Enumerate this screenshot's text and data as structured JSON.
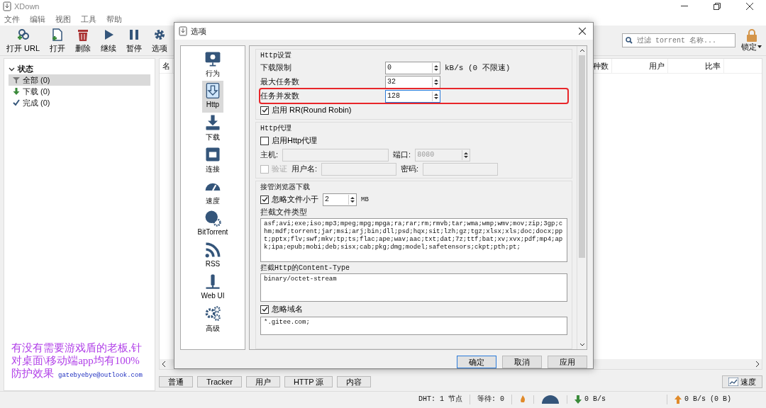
{
  "window": {
    "title": "XDown"
  },
  "menu": [
    "文件",
    "编辑",
    "视图",
    "工具",
    "帮助"
  ],
  "toolbar": [
    "打开 URL",
    "打开",
    "删除",
    "继续",
    "暂停",
    "选项"
  ],
  "search": {
    "placeholder": "过滤 torrent 名称..."
  },
  "lock": {
    "label": "锁定"
  },
  "sidebar": {
    "heading": "状态",
    "expanded": true,
    "items": [
      {
        "label": "全部 (0)",
        "selected": true
      },
      {
        "label": "下载 (0)",
        "selected": false
      },
      {
        "label": "完成 (0)",
        "selected": false
      }
    ]
  },
  "promo": {
    "text": "有没有需要游戏盾的老板,针对桌面\\移动端app均有100%防护效果",
    "link": "gatebyebye@outlook.com"
  },
  "table": {
    "columns": [
      "名",
      "种数",
      "用户",
      "比率"
    ]
  },
  "detail_tabs": [
    "普通",
    "Tracker",
    "用户",
    "HTTP 源",
    "内容"
  ],
  "speed_button": "速度",
  "status_bar": {
    "dht": "DHT: 1 节点",
    "waiting": "等待: 0",
    "download": "0 B/s",
    "upload": "0 B/s (0 B)"
  },
  "dialog": {
    "title": "选项",
    "nav": [
      {
        "label": "行为",
        "selected": false
      },
      {
        "label": "Http",
        "selected": true
      },
      {
        "label": "下载",
        "selected": false
      },
      {
        "label": "连接",
        "selected": false
      },
      {
        "label": "速度",
        "selected": false
      },
      {
        "label": "BitTorrent",
        "selected": false
      },
      {
        "label": "RSS",
        "selected": false
      },
      {
        "label": "Web UI",
        "selected": false
      },
      {
        "label": "高级",
        "selected": false
      }
    ],
    "http": {
      "title": "Http设置",
      "rows": [
        {
          "label": "下载限制",
          "value": "0",
          "suffix": "kB/s (0 不限速)",
          "highlighted": false,
          "focused": false
        },
        {
          "label": "最大任务数",
          "value": "32",
          "highlighted": false,
          "focused": false
        },
        {
          "label": "任务并发数",
          "value": "128",
          "highlighted": true,
          "focused": true
        }
      ],
      "round_robin": {
        "label": "启用 RR(Round Robin)",
        "checked": true
      }
    },
    "proxy": {
      "title": "Http代理",
      "enable": {
        "label": "启用Http代理",
        "checked": false
      },
      "disabled": true,
      "host_label": "主机:",
      "port_label": "端口:",
      "port_value": "8080",
      "auth": {
        "label": "验证",
        "checked": false
      },
      "user_label": "用户名:",
      "pass_label": "密码:"
    },
    "browser": {
      "title": "接管浏览器下载",
      "ignore_small": {
        "label": "忽略文件小于",
        "checked": true,
        "value": "2",
        "unit": "MB"
      },
      "types_label": "拦截文件类型",
      "types_text": "asf;avi;exe;iso;mp3;mpeg;mpg;mpga;ra;rar;rm;rmvb;tar;wma;wmp;wmv;mov;zip;3gp;chm;mdf;torrent;jar;msi;arj;bin;dll;psd;hqx;sit;lzh;gz;tgz;xlsx;xls;doc;docx;ppt;pptx;flv;swf;mkv;tp;ts;flac;ape;wav;aac;txt;dat;7z;ttf;bat;xv;xvx;pdf;mp4;apk;ipa;epub;mobi;deb;sisx;cab;pkg;dmg;model;safetensors;ckpt;pth;pt;",
      "content_type_label": "拦截Http的Content-Type",
      "content_type_text": "binary/octet-stream",
      "ignore_domains": {
        "label": "忽略域名",
        "checked": true
      },
      "domains_text": "*.gitee.com;"
    },
    "buttons": [
      {
        "label": "确定",
        "default": true
      },
      {
        "label": "取消",
        "default": false
      },
      {
        "label": "应用",
        "default": false
      }
    ]
  }
}
